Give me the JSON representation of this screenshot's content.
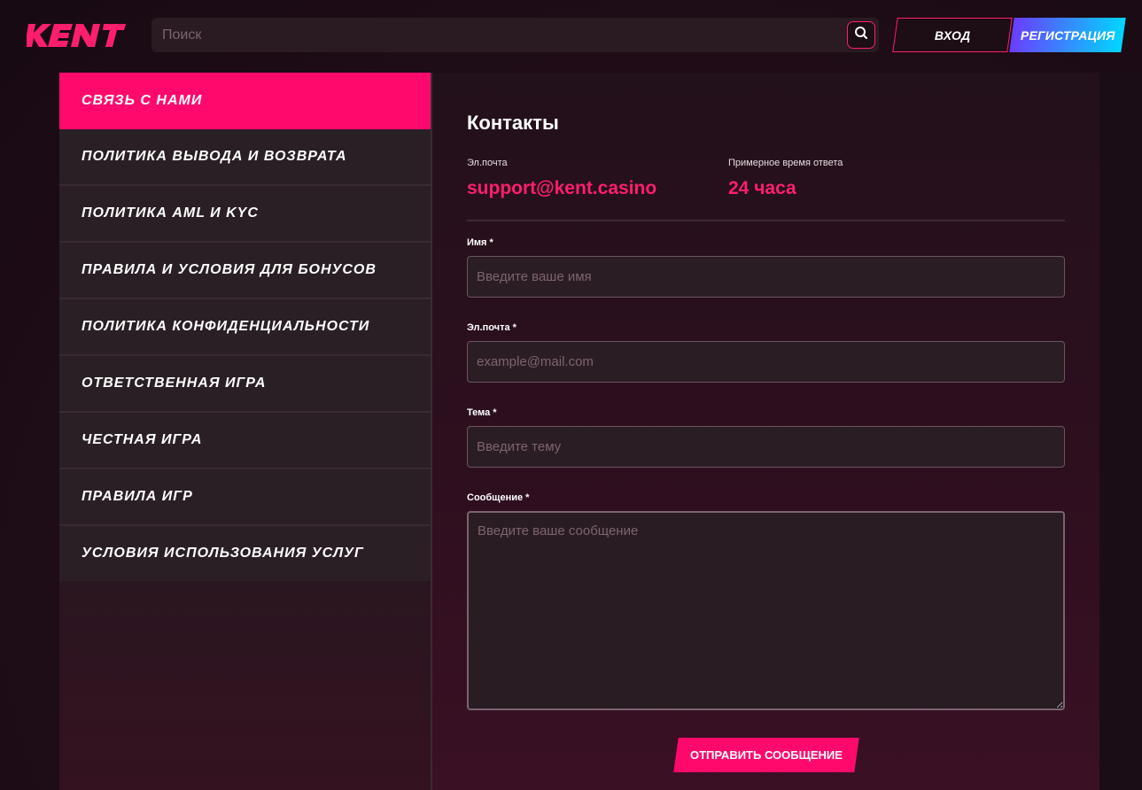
{
  "header": {
    "logo_text": "KENT",
    "search_placeholder": "Поиск",
    "login_label": "ВХОД",
    "register_label": "РЕГИСТРАЦИЯ",
    "search_icon": "search-icon"
  },
  "sidebar": {
    "items": [
      {
        "label": "СВЯЗЬ С НАМИ",
        "active": true
      },
      {
        "label": "ПОЛИТИКА ВЫВОДА И ВОЗВРАТА"
      },
      {
        "label": "ПОЛИТИКА AML И KYC"
      },
      {
        "label": "ПРАВИЛА И УСЛОВИЯ ДЛЯ БОНУСОВ"
      },
      {
        "label": "ПОЛИТИКА КОНФИДЕНЦИАЛЬНОСТИ"
      },
      {
        "label": "ОТВЕТСТВЕННАЯ ИГРА"
      },
      {
        "label": "ЧЕСТНАЯ ИГРА"
      },
      {
        "label": "ПРАВИЛА ИГР"
      },
      {
        "label": "УСЛОВИЯ ИСПОЛЬЗОВАНИЯ УСЛУГ"
      }
    ]
  },
  "contacts": {
    "title": "Контакты",
    "email_label": "Эл.почта",
    "email_value": "support@kent.casino",
    "response_label": "Примерное время ответа",
    "response_value": "24 часа"
  },
  "form": {
    "name_label": "Имя *",
    "name_placeholder": "Введите ваше имя",
    "email_label": "Эл.почта *",
    "email_placeholder": "example@mail.com",
    "subject_label": "Тема *",
    "subject_placeholder": "Введите тему",
    "message_label": "Сообщение *",
    "message_placeholder": "Введите ваше сообщение",
    "submit_label": "ОТПРАВИТЬ СООБЩЕНИЕ"
  },
  "colors": {
    "accent": "#ff0a6c",
    "register_gradient_start": "#6a3dff",
    "register_gradient_end": "#00d7ff"
  }
}
